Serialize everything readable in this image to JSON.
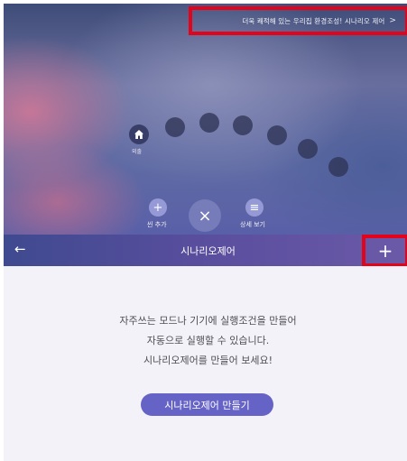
{
  "header_banner": {
    "text": "더욱 쾌적해 있는 우리집 환경조성! 시나리오 제어",
    "chevron": ">"
  },
  "dial": {
    "home_label": "외출",
    "home_icon": "home-icon"
  },
  "actions": {
    "add_scene": {
      "icon": "+",
      "label": "씬 추가"
    },
    "close": {
      "icon": "×"
    },
    "details": {
      "icon": "≡",
      "label": "상세 보기"
    }
  },
  "navbar": {
    "back_icon": "←",
    "title": "시나리오제어",
    "add_icon": "+"
  },
  "content": {
    "line1": "자주쓰는 모드나 기기에 실행조건을 만들어",
    "line2": "자동으로 실행할 수 있습니다.",
    "line3": "시나리오제어를 만들어 보세요!",
    "cta": "시나리오제어 만들기"
  },
  "colors": {
    "accent": "#6663c6",
    "highlight": "#e3041b",
    "navbar": "#4a4e97",
    "content_bg": "#f3f2f9"
  }
}
